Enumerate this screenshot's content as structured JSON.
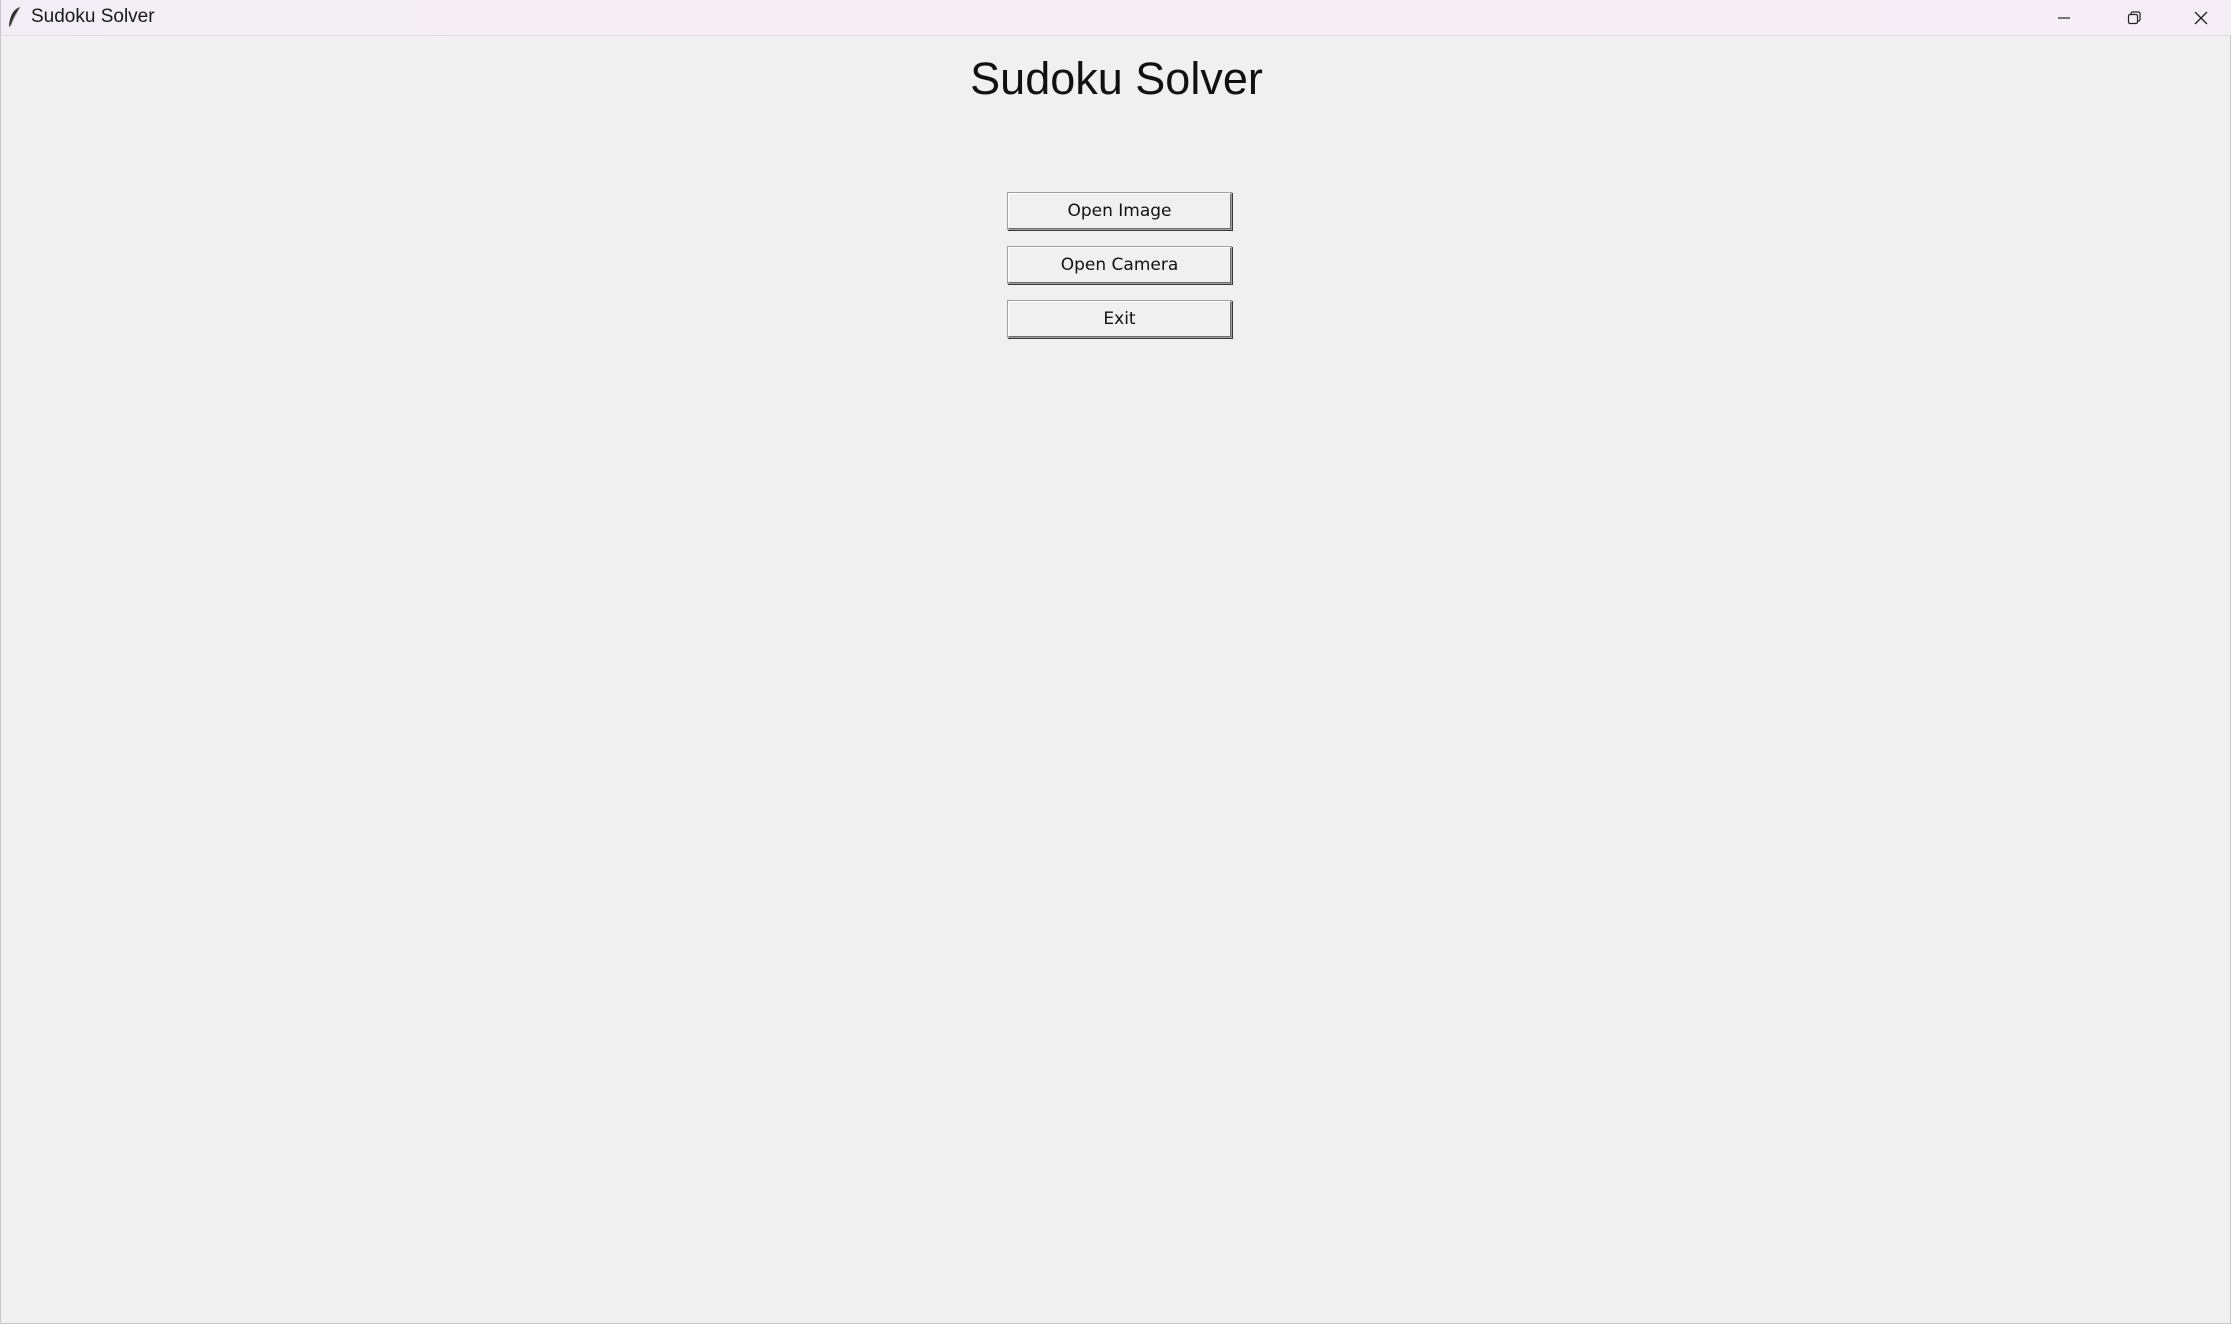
{
  "window": {
    "title": "Sudoku Solver",
    "app_icon": "feather-icon",
    "controls": {
      "minimize_icon": "minimize-icon",
      "maximize_icon": "restore-icon",
      "close_icon": "close-icon"
    }
  },
  "main": {
    "heading": "Sudoku Solver",
    "buttons": [
      {
        "label": "Open Image"
      },
      {
        "label": "Open Camera"
      },
      {
        "label": "Exit"
      }
    ]
  },
  "colors": {
    "background": "#f0f0f0",
    "text": "#111111"
  }
}
